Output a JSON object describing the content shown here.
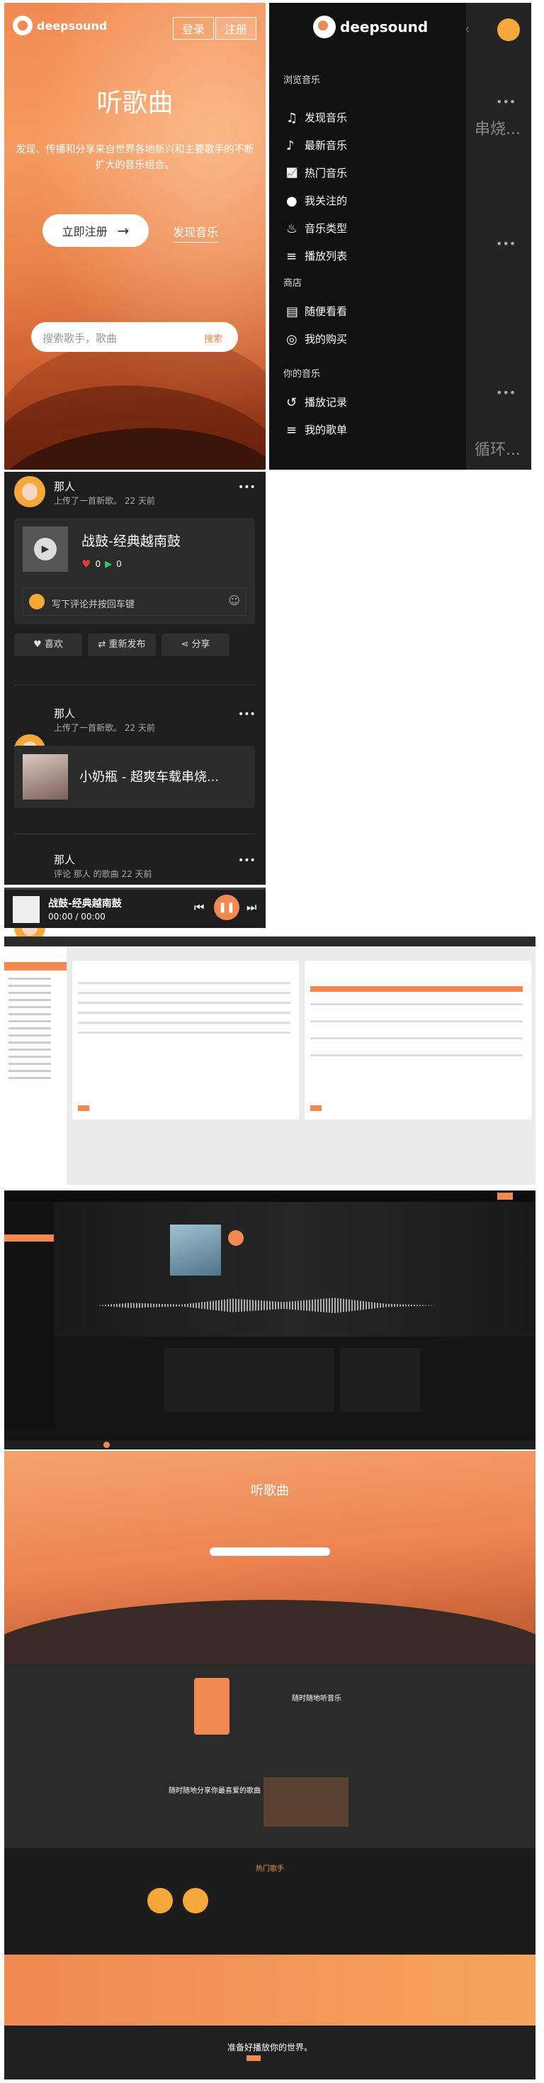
{
  "hero": {
    "brand": "deepsound",
    "login": "登录",
    "signup": "注册",
    "title": "听歌曲",
    "subtitle": "发现、传播和分享来自世界各地新兴和主要歌手的不断扩大的音乐组合。",
    "register_now": "立即注册",
    "discover": "发现音乐",
    "search_placeholder": "搜索歌手，歌曲",
    "search_btn": "搜索"
  },
  "sidebar": {
    "brand": "deepsound",
    "browse_title": "浏览音乐",
    "browse": [
      {
        "icon": "♫",
        "label": "发现音乐"
      },
      {
        "icon": "♪",
        "label": "最新音乐"
      },
      {
        "icon": "📈",
        "label": "热门音乐"
      },
      {
        "icon": "●",
        "label": "我关注的"
      },
      {
        "icon": "♨",
        "label": "音乐类型"
      },
      {
        "icon": "≡",
        "label": "播放列表"
      }
    ],
    "store_title": "商店",
    "store": [
      {
        "icon": "▤",
        "label": "随便看看"
      },
      {
        "icon": "◎",
        "label": "我的购买"
      }
    ],
    "yours_title": "你的音乐",
    "yours": [
      {
        "icon": "↺",
        "label": "播放记录"
      },
      {
        "icon": "≡",
        "label": "我的歌单"
      }
    ],
    "bg_text_1": "串烧...",
    "bg_text_2": "循环..."
  },
  "feed": {
    "post1": {
      "user": "那人",
      "meta": "上传了一首新歌。 22 天前",
      "song": "战鼓-经典越南鼓",
      "likes": "0",
      "plays": "0",
      "comment_placeholder": "写下评论并按回车键"
    },
    "actions": {
      "like": "喜欢",
      "repost": "重新发布",
      "share": "分享"
    },
    "post2": {
      "user": "那人",
      "meta": "上传了一首新歌。 22 天前",
      "song": "小奶瓶 - 超爽车载串烧..."
    },
    "post3": {
      "user": "那人",
      "meta": "评论 那人 的歌曲 22 天前"
    }
  },
  "player": {
    "song": "战鼓-经典越南鼓",
    "time": "00:00 / 00:00"
  },
  "landing": {
    "title": "听歌曲",
    "section1_title": "随时随地听音乐",
    "section2_title": "随时随地分享你最喜爱的歌曲",
    "hot_title": "热门歌手",
    "cta_title": "准备好播放你的世界。"
  },
  "colors": {
    "accent": "#f08a52",
    "dark": "#111111",
    "panel": "#1e1e1e"
  }
}
